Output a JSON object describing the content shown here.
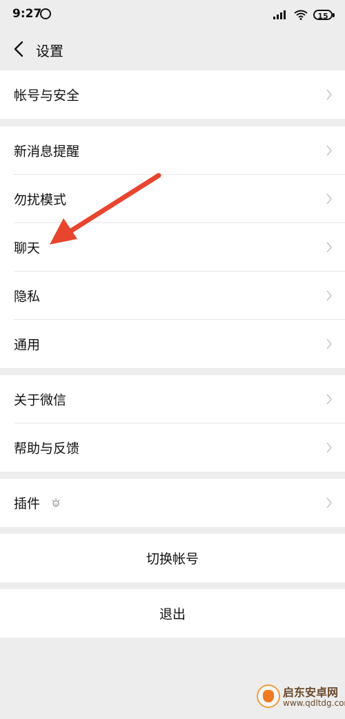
{
  "status_bar": {
    "time": "9:27",
    "battery": "15"
  },
  "nav": {
    "title": "设置"
  },
  "groups": [
    {
      "items": [
        {
          "label": "帐号与安全"
        }
      ]
    },
    {
      "items": [
        {
          "label": "新消息提醒"
        },
        {
          "label": "勿扰模式"
        },
        {
          "label": "聊天"
        },
        {
          "label": "隐私"
        },
        {
          "label": "通用"
        }
      ]
    },
    {
      "items": [
        {
          "label": "关于微信"
        },
        {
          "label": "帮助与反馈"
        }
      ]
    },
    {
      "items": [
        {
          "label": "插件"
        }
      ]
    }
  ],
  "actions": {
    "switch_account": "切换帐号",
    "logout": "退出"
  },
  "watermark": {
    "title": "启东安卓网",
    "url": "www.qdltdg.com"
  },
  "colors": {
    "background": "#ededed",
    "row": "#ffffff",
    "annotation_arrow": "#e8452f"
  },
  "icons": {
    "back": "chevron-left-icon",
    "row_chevron": "chevron-right-icon",
    "plugin_badge": "sun-badge-icon"
  }
}
